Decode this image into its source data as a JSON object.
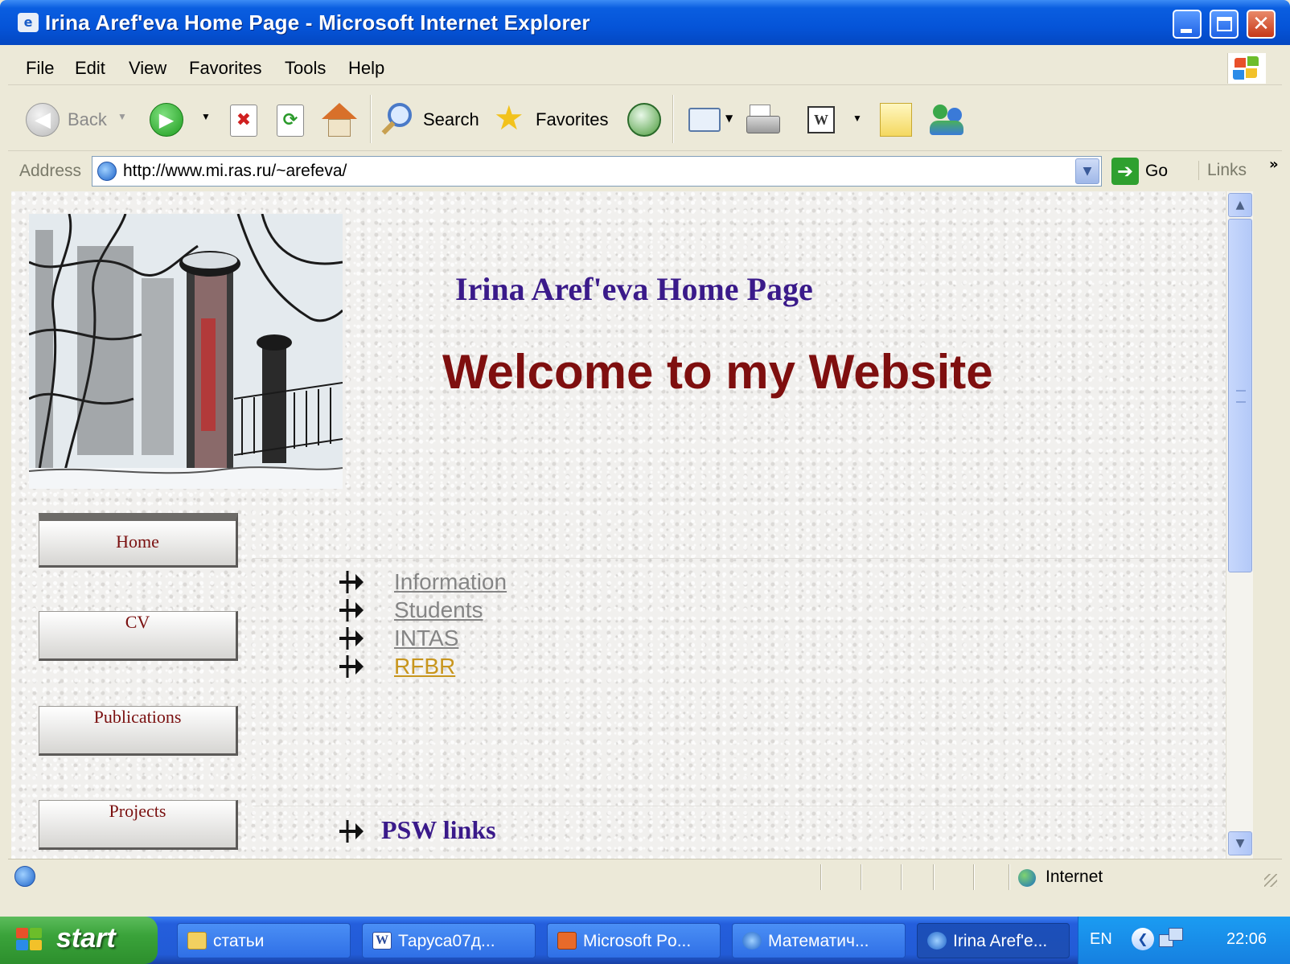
{
  "window": {
    "title": "Irina Aref'eva Home Page - Microsoft Internet Explorer"
  },
  "menu": [
    "File",
    "Edit",
    "View",
    "Favorites",
    "Tools",
    "Help"
  ],
  "toolbar": {
    "back_label": "Back",
    "search_label": "Search",
    "favorites_label": "Favorites"
  },
  "address": {
    "label": "Address",
    "url": "http://www.mi.ras.ru/~arefeva/",
    "go_label": "Go",
    "links_label": "Links",
    "chevron": "»"
  },
  "page": {
    "title": "Irina Aref'eva Home Page",
    "welcome": "Welcome to my Website",
    "nav_buttons": [
      "Home",
      "CV",
      "Publications",
      "Projects"
    ],
    "links": [
      {
        "label": "Information",
        "visited": false
      },
      {
        "label": "Students",
        "visited": false
      },
      {
        "label": "INTAS",
        "visited": false
      },
      {
        "label": "RFBR",
        "visited": true
      }
    ],
    "psw_links": "PSW links"
  },
  "status": {
    "zone": "Internet"
  },
  "taskbar": {
    "start_label": "start",
    "tasks": [
      {
        "label": "статьи",
        "icon": "folder-icon",
        "active": false
      },
      {
        "label": "Таруса07д...",
        "icon": "word-icon",
        "active": false
      },
      {
        "label": "Microsoft Po...",
        "icon": "powerpoint-icon",
        "active": false
      },
      {
        "label": "Математич...",
        "icon": "ie-icon",
        "active": false
      },
      {
        "label": "Irina Aref'e...",
        "icon": "ie-icon",
        "active": true
      }
    ],
    "language": "EN",
    "clock": "22:06"
  },
  "colors": {
    "title_bar": "#0554d8",
    "page_title": "#3a1a8a",
    "welcome_text": "#7f0f0f",
    "link_unvisited": "#858585",
    "link_visited": "#c8961e",
    "taskbar": "#225bd6",
    "start_button": "#3aa33a"
  }
}
